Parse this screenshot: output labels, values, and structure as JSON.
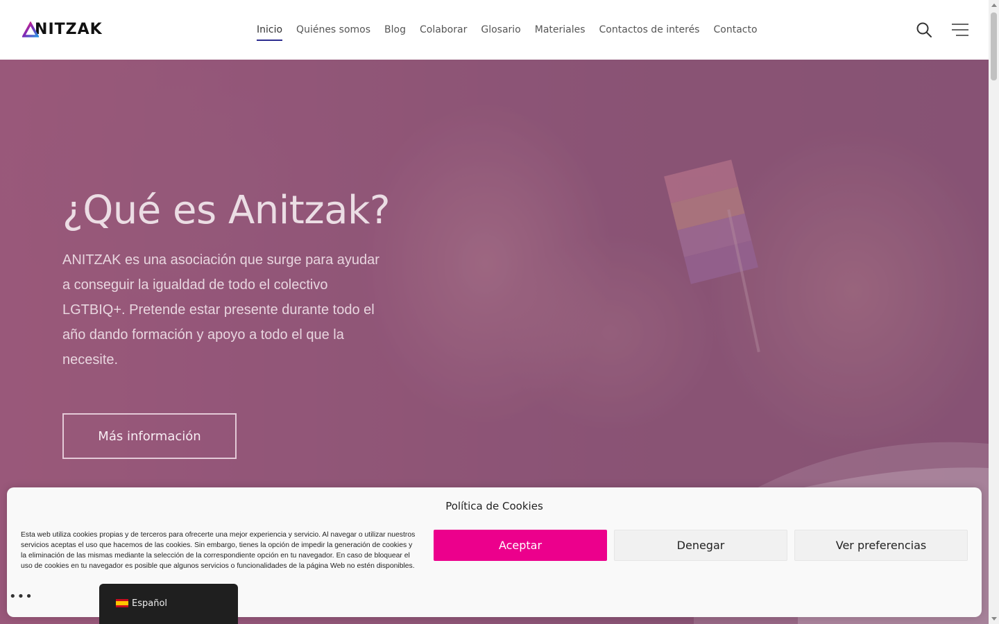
{
  "header": {
    "logo_text": "ANITZAK",
    "nav": [
      {
        "label": "Inicio",
        "active": true
      },
      {
        "label": "Quiénes somos"
      },
      {
        "label": "Blog"
      },
      {
        "label": "Colaborar"
      },
      {
        "label": "Glosario"
      },
      {
        "label": "Materiales"
      },
      {
        "label": "Contactos de interés"
      },
      {
        "label": "Contacto"
      }
    ],
    "search_icon": "search-icon",
    "menu_icon": "hamburger-menu-icon"
  },
  "hero": {
    "title": "¿Qué es Anitzak?",
    "text": "ANITZAK es una asociación que surge para ayudar a conseguir la igualdad de todo el colectivo LGTBIQ+. Pretende estar presente durante todo el año dando formación y apoyo a todo el que la necesite.",
    "button_label": "Más información"
  },
  "cookie_banner": {
    "title": "Política de Cookies",
    "text": "Esta web utiliza cookies propias y de terceros para ofrecerte una mejor experiencia y servicio. Al navegar o utilizar nuestros servicios aceptas el uso que hacemos de las cookies. Sin embargo, tienes la opción de impedir la generación de cookies y la eliminación de las mismas mediante la selección de la correspondiente opción en tu navegador. En caso de bloquear el uso de cookies en tu navegador es posible que algunos servicios o funcionalidades de la página Web no estén disponibles.",
    "accept_label": "Aceptar",
    "deny_label": "Denegar",
    "prefs_label": "Ver preferencias",
    "accent_color": "#ec008c"
  },
  "language_switcher": {
    "label": "Español",
    "flag_icon": "spain-flag-icon"
  }
}
